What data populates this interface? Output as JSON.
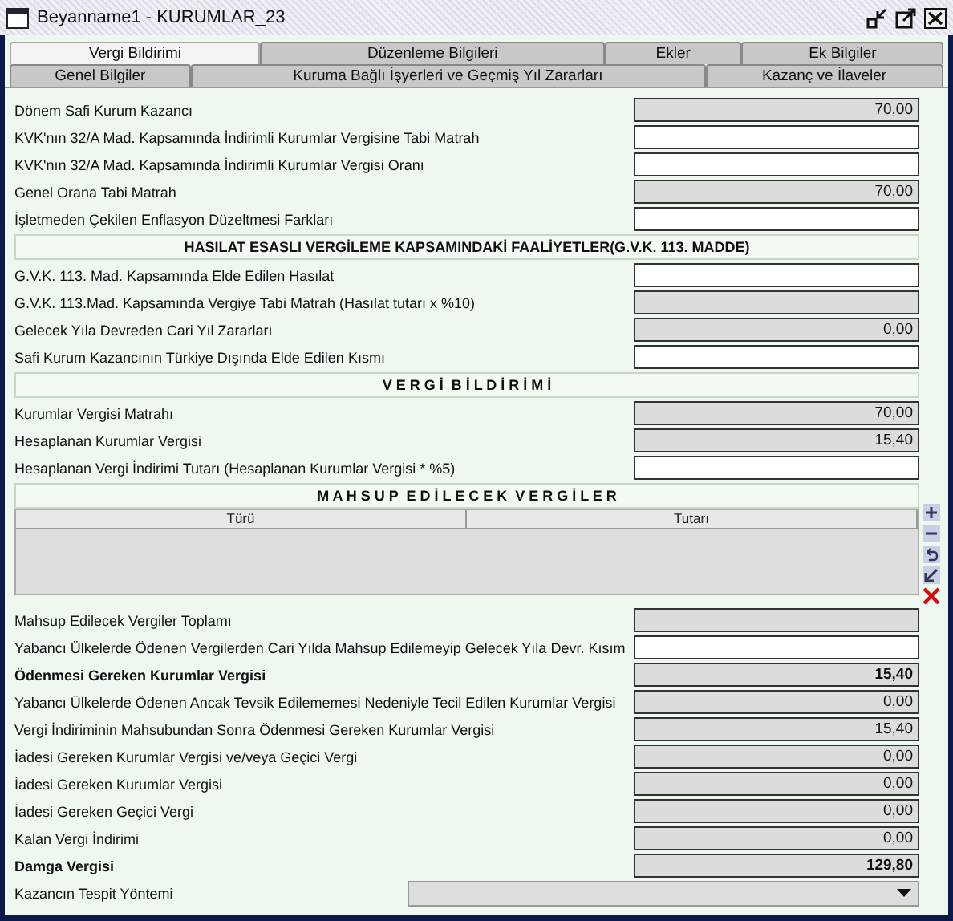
{
  "window": {
    "title": "Beyanname1 - KURUMLAR_23"
  },
  "tab_rows": [
    {
      "tabs": [
        {
          "label": "Vergi Bildirimi",
          "selected": true
        },
        {
          "label": "Düzenleme Bilgileri",
          "selected": false
        },
        {
          "label": "Ekler",
          "selected": false
        },
        {
          "label": "Ek Bilgiler",
          "selected": false
        }
      ]
    },
    {
      "tabs": [
        {
          "label": "Genel Bilgiler",
          "selected": false
        },
        {
          "label": "Kuruma Bağlı İşyerleri ve Geçmiş Yıl Zararları",
          "selected": false
        },
        {
          "label": "Kazanç ve İlaveler",
          "selected": false
        }
      ]
    }
  ],
  "rows": [
    {
      "kind": "field",
      "label": "Dönem Safi Kurum Kazancı",
      "value": "70,00",
      "readonly": true,
      "bold": false
    },
    {
      "kind": "field",
      "label": "KVK'nın 32/A Mad. Kapsamında İndirimli Kurumlar Vergisine Tabi Matrah",
      "readonly": false,
      "bold": false
    },
    {
      "kind": "field",
      "label": "KVK'nın 32/A Mad. Kapsamında İndirimli Kurumlar Vergisi Oranı",
      "readonly": false,
      "bold": false
    },
    {
      "kind": "field",
      "label": "Genel Orana Tabi Matrah",
      "value": "70,00",
      "readonly": true,
      "bold": false
    },
    {
      "kind": "field",
      "label": "İşletmeden Çekilen Enflasyon Düzeltmesi Farkları",
      "readonly": false,
      "bold": false
    },
    {
      "kind": "header",
      "title": "HASILAT ESASLI VERGİLEME KAPSAMINDAKİ FAALİYETLER(G.V.K. 113. MADDE)"
    },
    {
      "kind": "field",
      "label": "G.V.K. 113. Mad. Kapsamında Elde Edilen Hasılat",
      "readonly": false,
      "bold": false
    },
    {
      "kind": "field",
      "label": "G.V.K. 113.Mad. Kapsamında Vergiye Tabi Matrah (Hasılat tutarı x %10)",
      "readonly": true,
      "bold": false
    },
    {
      "kind": "field",
      "label": "Gelecek Yıla Devreden Cari Yıl Zararları",
      "value": "0,00",
      "readonly": true,
      "bold": false
    },
    {
      "kind": "field",
      "label": "Safi Kurum Kazancının Türkiye Dışında Elde Edilen Kısmı",
      "readonly": false,
      "bold": false
    },
    {
      "kind": "header",
      "title": "V E R G İ  B İ L D İ R İ M İ"
    },
    {
      "kind": "field",
      "label": "Kurumlar Vergisi Matrahı",
      "value": "70,00",
      "readonly": true,
      "bold": false
    },
    {
      "kind": "field",
      "label": "Hesaplanan Kurumlar Vergisi",
      "value": "15,40",
      "readonly": true,
      "bold": false
    },
    {
      "kind": "field",
      "label": "Hesaplanan Vergi İndirimi Tutarı (Hesaplanan Kurumlar Vergisi * %5)",
      "readonly": false,
      "bold": false
    },
    {
      "kind": "table",
      "title": "M A H S U P  E D İ L E C E K  V E R G İ L E R",
      "columns": [
        "Türü",
        "Tutarı"
      ]
    },
    {
      "kind": "field",
      "label": "Mahsup Edilecek Vergiler Toplamı",
      "readonly": true,
      "bold": false
    },
    {
      "kind": "field",
      "label": "Yabancı Ülkelerde Ödenen Vergilerden Cari Yılda Mahsup Edilemeyip Gelecek Yıla Devr. Kısım",
      "readonly": false,
      "bold": false
    },
    {
      "kind": "field",
      "label": "Ödenmesi Gereken Kurumlar Vergisi",
      "value": "15,40",
      "readonly": true,
      "bold": true
    },
    {
      "kind": "field",
      "label": "Yabancı Ülkelerde Ödenen Ancak Tevsik Edilememesi Nedeniyle Tecil Edilen Kurumlar Vergisi",
      "value": "0,00",
      "readonly": true,
      "bold": false
    },
    {
      "kind": "field",
      "label": "Vergi İndiriminin Mahsubundan Sonra Ödenmesi Gereken Kurumlar Vergisi",
      "value": "15,40",
      "readonly": true,
      "bold": false
    },
    {
      "kind": "field",
      "label": "İadesi Gereken Kurumlar Vergisi ve/veya Geçici Vergi",
      "value": "0,00",
      "readonly": true,
      "bold": false
    },
    {
      "kind": "field",
      "label": "İadesi Gereken Kurumlar Vergisi",
      "value": "0,00",
      "readonly": true,
      "bold": false
    },
    {
      "kind": "field",
      "label": "İadesi Gereken Geçici Vergi",
      "value": "0,00",
      "readonly": true,
      "bold": false
    },
    {
      "kind": "field",
      "label": "Kalan Vergi İndirimi",
      "value": "0,00",
      "readonly": true,
      "bold": false
    },
    {
      "kind": "field",
      "label": "Damga Vergisi",
      "value": "129,80",
      "readonly": true,
      "bold": true
    },
    {
      "kind": "combo",
      "label": "Kazancın Tespit Yöntemi"
    }
  ]
}
